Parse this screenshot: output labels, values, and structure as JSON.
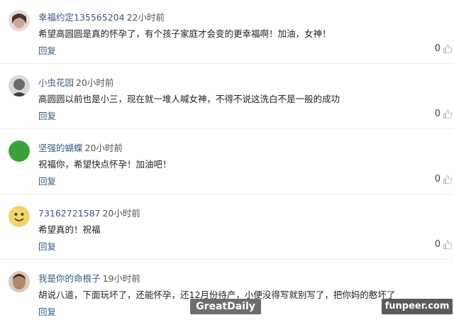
{
  "comments": [
    {
      "username": "幸福约定135565204",
      "time": "22小时前",
      "text": "希望高圆圆是真的怀孕了，有个孩子家庭才会变的更幸福啊！加油，女神！",
      "reply_label": "回复",
      "likes": "0",
      "avatar_color": "#8a6b5c"
    },
    {
      "username": "小虫花园",
      "time": "20小时前",
      "text": "高圆圆以前也是小三，现在就一堆人喊女神，不得不说这洗白不是一般的成功",
      "reply_label": "回复",
      "likes": "0",
      "avatar_color": "#5b5b5b"
    },
    {
      "username": "坚强的蝴蝶",
      "time": "20小时前",
      "text": "祝福你，希望快点怀孕！加油吧！",
      "reply_label": "回复",
      "likes": "0",
      "avatar_color": "#3aa23a"
    },
    {
      "username": "73162721587",
      "time": "20小时前",
      "text": "希望真的！祝福",
      "reply_label": "回复",
      "likes": "0",
      "avatar_color": "#e7c24a"
    },
    {
      "username": "我是你的命根子",
      "time": "19小时前",
      "text": "胡说八道，下面玩坏了，还能怀孕，还12月份待产，小便没得写就别写了，把你妈的憨坏了",
      "reply_label": "回复",
      "likes": "0",
      "avatar_color": "#7d5a44"
    }
  ],
  "watermarks": {
    "left": "GreatDaily",
    "right": "funpeer.com"
  },
  "colors": {
    "username": "#3a5a86",
    "reply": "#3a5a86",
    "divider": "#ececec"
  }
}
